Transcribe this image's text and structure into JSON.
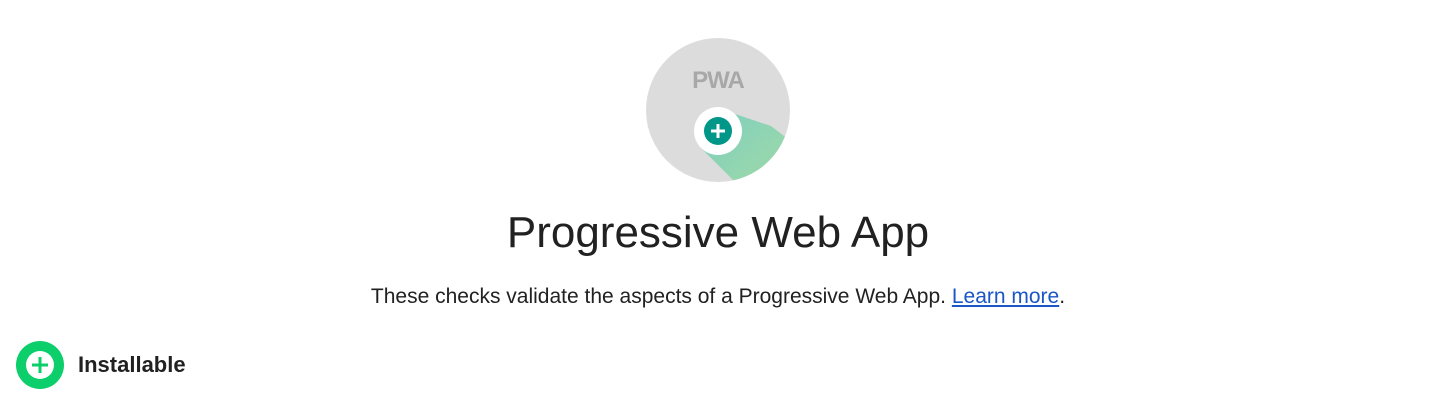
{
  "category": {
    "logo_text": "PWA",
    "title": "Progressive Web App",
    "description": "These checks validate the aspects of a Progressive Web App.",
    "learn_more": "Learn more",
    "period": "."
  },
  "groups": [
    {
      "label": "Installable",
      "icon": "plus-circle-icon"
    }
  ],
  "colors": {
    "teal": "#009688",
    "green": "#0cce6b",
    "link": "#1a56c5",
    "gray": "#dcdcdc"
  }
}
